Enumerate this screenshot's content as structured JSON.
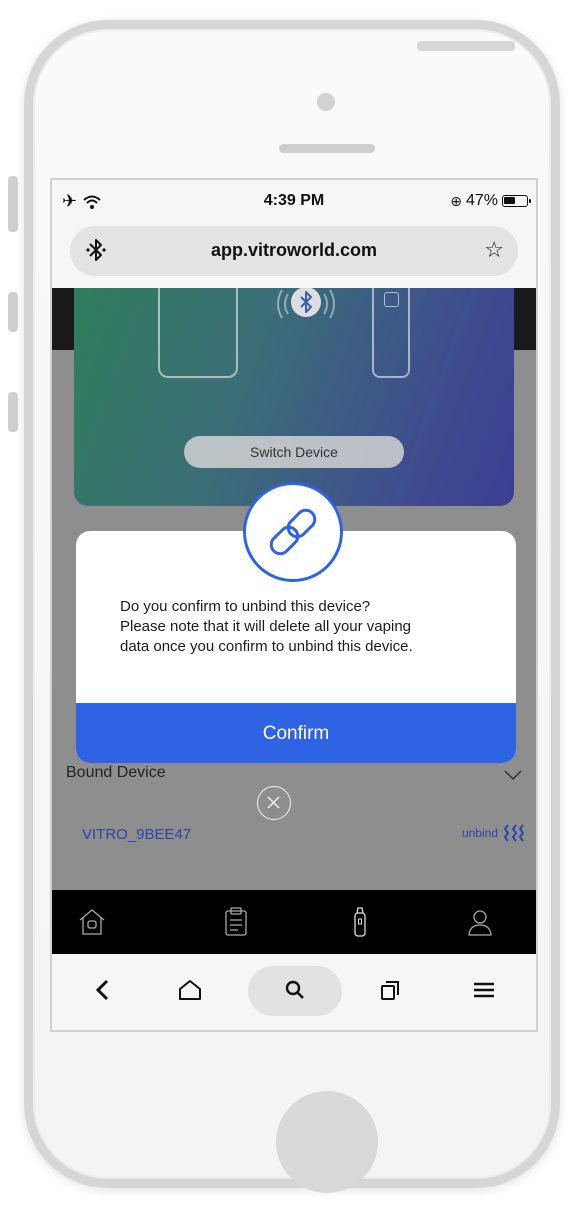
{
  "status_bar": {
    "time": "4:39 PM",
    "battery": "47%",
    "battery_level": 0.47,
    "icons": [
      "airplane-icon",
      "wifi-icon",
      "orientation-lock-icon",
      "battery-icon"
    ]
  },
  "browser": {
    "url": "app.vitroworld.com",
    "left_icon": "bluetooth-icon",
    "right_icon": "star-icon",
    "toolbar": [
      "back-icon",
      "home-icon",
      "search-icon",
      "tabs-icon",
      "menu-icon"
    ]
  },
  "hero": {
    "switch_device_label": "Switch Device"
  },
  "dialog": {
    "message_lines": [
      "Do you confirm to unbind this device?",
      "Please note that it will delete all your vaping",
      "data once you confirm to unbind this device."
    ],
    "confirm_label": "Confirm",
    "icon": "link-icon"
  },
  "bound": {
    "label": "Bound Device",
    "device_name": "VITRO_9BEE47",
    "unbind_label": "unbind"
  },
  "app_nav": [
    "home-icon",
    "clipboard-icon",
    "device-icon",
    "profile-icon"
  ],
  "colors": {
    "accent": "#2e63e3",
    "link": "#2a47a8",
    "overlay": "#8e8e8e"
  }
}
